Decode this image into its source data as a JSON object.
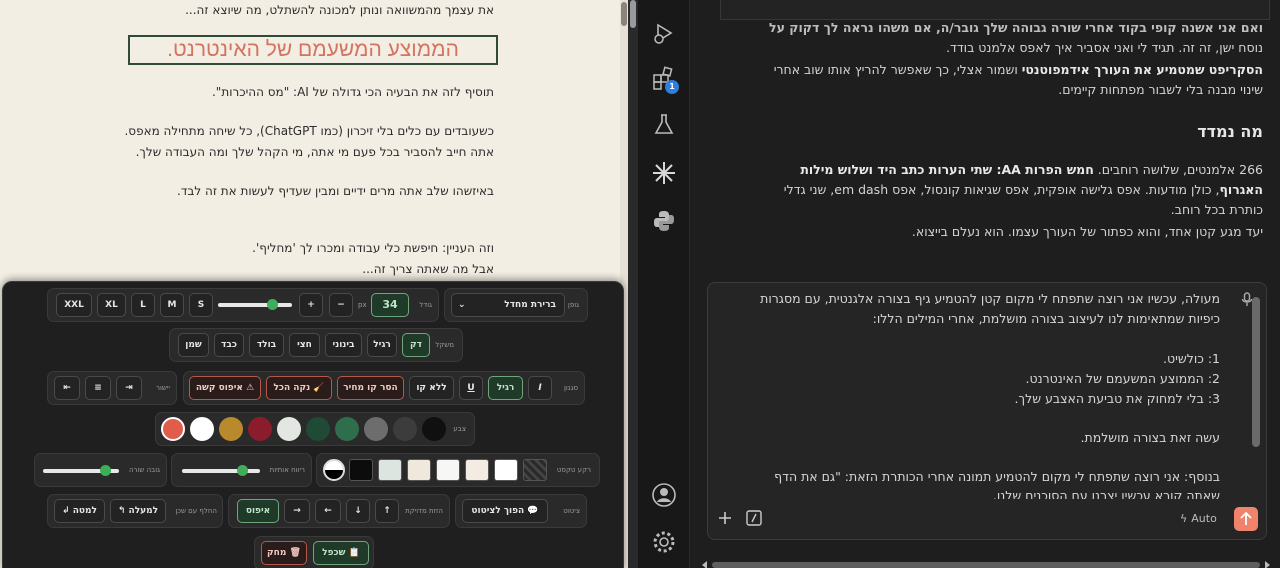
{
  "document": {
    "lines": [
      "את עצמך מהמשוואה ונותן למכונה להשתלט, מה שיוצא זה...",
      "תוסיף לזה את הבעיה הכי גדולה של AI: \"מס ההיכרות\".",
      "כשעובדים עם כלים בלי זיכרון (כמו ChatGPT), כל שיחה מתחילה מאפס.",
      "אתה חייב להסביר בכל פעם מי אתה, מי הקהל שלך ומה העבודה שלך.",
      "באיזשהו שלב אתה מרים ידיים ומבין שעדיף לעשות את זה לבד.",
      "וזה העניין: חיפשת כלי עבודה ומכרו לך 'מחליף'.",
      "אבל מה שאתה צריך זה..."
    ],
    "heading": "הממוצע המשעמם של האינטרנט."
  },
  "toolbar": {
    "row1": {
      "font_label": "גופן",
      "font_select": "ברירת מחדל",
      "size_label": "גודל",
      "size_value": "34",
      "size_unit": "px",
      "minus": "−",
      "plus": "+",
      "sizes": [
        "S",
        "M",
        "L",
        "XL",
        "XXL"
      ],
      "slider_level": 0.78
    },
    "row2": {
      "weight_label": "משקל",
      "weights": [
        "דק",
        "רגיל",
        "בינוני",
        "חצי",
        "בולד",
        "כבד",
        "שמן"
      ]
    },
    "row3": {
      "style_label": "סגנון",
      "italic": "I",
      "regular": "רגיל",
      "underline": "U",
      "no_line": "ללא קו",
      "remove_strike": "הסר קו מחיר",
      "clean_all": "נקה הכל",
      "hard_reset": "איפוס קשה",
      "align_label": "יישור",
      "align_buttons": [
        "⇥",
        "≡",
        "⇤"
      ]
    },
    "row4": {
      "color_label": "צבע",
      "colors": [
        "#101010",
        "#3c3c3c",
        "#6d6d6d",
        "#2e6e4c",
        "#1f4a35",
        "#e2e8e1",
        "#8a1c2b",
        "#b98a2c",
        "#ffffff",
        "#e25c4a"
      ]
    },
    "row5": {
      "bg_label": "רקע טקסט",
      "bg_swatches": [
        "#ffffff",
        "#f3ece2",
        "#f7f7f5",
        "#efe8dd",
        "#dde5e0",
        "#0c0c0c"
      ],
      "spacing_label": "ריווח אותיות",
      "spacing_level": 0.82,
      "line_label": "גובה שורה",
      "line_level": 0.88
    },
    "row6": {
      "quote_label": "ציטוט",
      "quote_btn": "הפוך לציטוט",
      "move_label": "הזזת מדויקת",
      "arrows": [
        "↑",
        "↓",
        "←",
        "→"
      ],
      "reset": "איפוס",
      "swap_label": "החלף עם שכן",
      "up": "למעלה",
      "down": "למטה"
    },
    "row7": {
      "duplicate": "שכפל",
      "delete": "מחק"
    }
  },
  "chat": {
    "top_line": "ואם אני אשנה קופי בקוד אחרי שורה גבוהה שלך גובר/ה, אם משהו נראה לך דקוק על",
    "lines_before": [
      "נוסח ישן, זה זה. תגיד לי ואני אסביר איך לאפס אלמנט בודד."
    ],
    "bold_lead": "הסקריפט שמטמיע את העורך אידמפוטנטי",
    "bold_rest": " ושמור אצלי, כך שאפשר להריץ אותו שוב אחרי",
    "line_after_bold": "שינוי מבנה בלי לשבור מפתחות קיימים.",
    "section_title": "מה נמדד",
    "measure_1a": "266 אלמנטים, שלושה רוחבים. ",
    "measure_1b": "חמש הפרות AA: שתי הערות כתב היד ושלוש מילות",
    "measure_2a": "האגרוף",
    "measure_2b": ", כולן מודעות. אפס גלישה אופקית, אפס שגיאות קונסול, אפס em dash, שני גדלי",
    "measure_3": "כותרת בכל רוחב.",
    "measure_4": "יעד מגע קטן אחד, והוא כפתור של העורך עצמו. הוא נעלם בייצוא.",
    "input_lines": [
      "מעולה, עכשיו אני רוצה שתפתח לי מקום קטן להטמיע גיף בצורה אלגנטית, עם מסגרות",
      "כיפיות שמתאימות לנו לעיצוב בצורה מושלמת, אחרי המילים הללו:",
      "",
      "1: כולשיט.",
      "2: הממוצע המשעמם של האינטרנט.",
      "3: בלי למחוק את טביעת האצבע שלך.",
      "",
      "עשה זאת בצורה מושלמת.",
      "",
      "בנוסף: אני רוצה שתפתח לי מקום להטמיע תמונה אחרי הכותרת הזאת: \"גם את הדף",
      "שאתה קורא עכשיו יצרנו עם הסוכנים שלנו."
    ],
    "auto_label": "Auto",
    "badge": "1"
  }
}
